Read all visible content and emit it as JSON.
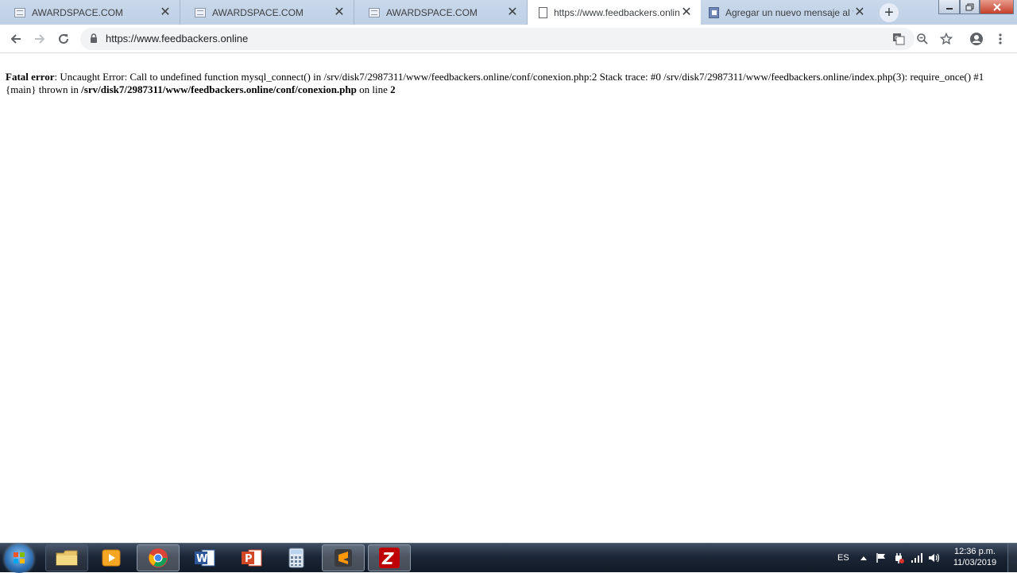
{
  "browser": {
    "tabs": [
      {
        "title": "AWARDSPACE.COM",
        "active": false,
        "icon": "site-favicon"
      },
      {
        "title": "AWARDSPACE.COM",
        "active": false,
        "icon": "site-favicon"
      },
      {
        "title": "AWARDSPACE.COM",
        "active": false,
        "icon": "site-favicon"
      },
      {
        "title": "https://www.feedbackers.online",
        "active": true,
        "icon": "document-icon"
      },
      {
        "title": "Agregar un nuevo mensaje al fo",
        "active": false,
        "icon": "form-favicon"
      }
    ],
    "new_tab_label": "+",
    "close_glyph": "✕",
    "url": "https://www.feedbackers.online"
  },
  "error": {
    "label": "Fatal error",
    "message": ": Uncaught Error: Call to undefined function mysql_connect() in /srv/disk7/2987311/www/feedbackers.online/conf/conexion.php:2 Stack trace: #0 /srv/disk7/2987311/www/feedbackers.online/index.php(3): require_once() #1 {main} thrown in ",
    "file": "/srv/disk7/2987311/www/feedbackers.online/conf/conexion.php",
    "line_text": " on line ",
    "line": "2"
  },
  "taskbar": {
    "apps": [
      "file-explorer",
      "media-player",
      "chrome",
      "word",
      "powerpoint",
      "calculator",
      "sublime-text",
      "filezilla"
    ],
    "language": "ES",
    "time": "12:36 p.m.",
    "date": "11/03/2019"
  },
  "colors": {
    "tabstrip": "#c9d8ea",
    "omnibox": "#f1f3f4",
    "taskbar": "#1b2636"
  }
}
